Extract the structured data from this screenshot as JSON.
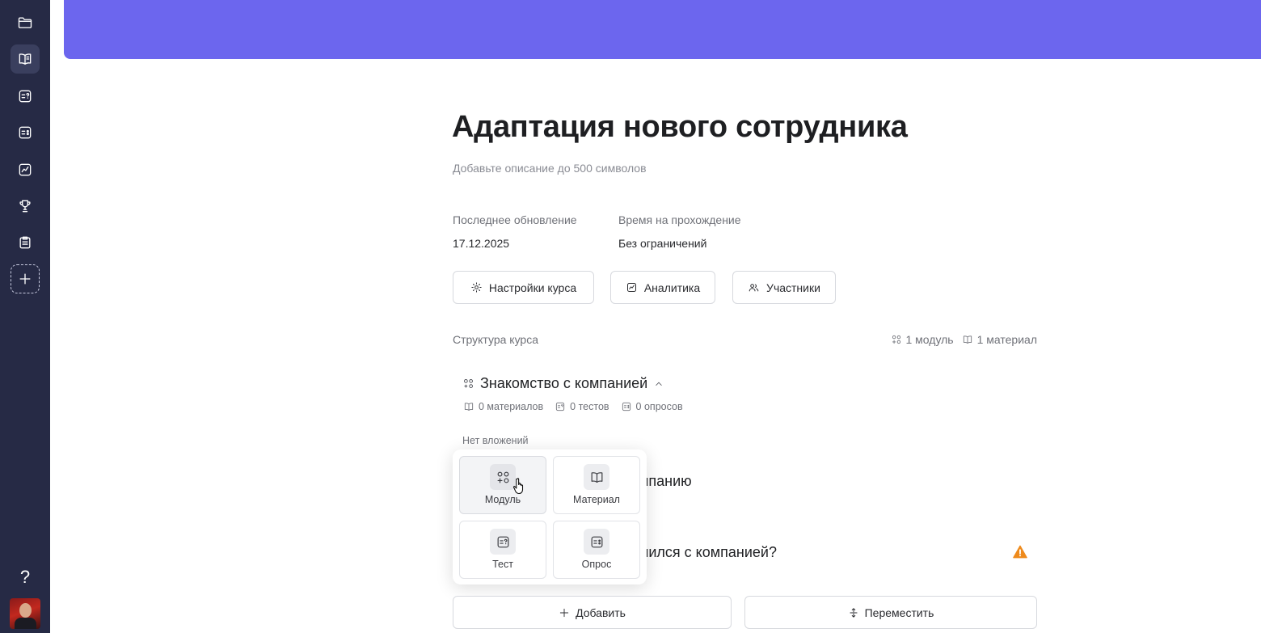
{
  "sidebar": {
    "items": [
      {
        "icon": "folder-icon"
      },
      {
        "icon": "book-icon",
        "active": true
      },
      {
        "icon": "test-icon"
      },
      {
        "icon": "survey-icon"
      },
      {
        "icon": "analytics-icon"
      },
      {
        "icon": "trophy-icon"
      },
      {
        "icon": "clipboard-icon"
      },
      {
        "icon": "plus-icon"
      }
    ],
    "help_label": "?"
  },
  "colors": {
    "banner": "#6c66ee",
    "sidebar": "#262a45",
    "warning": "#ee8a1c"
  },
  "course": {
    "title": "Адаптация нового сотрудника",
    "description_placeholder": "Добавьте описание до 500 символов",
    "meta": {
      "updated_label": "Последнее обновление",
      "updated_value": "17.12.2025",
      "time_label": "Время на прохождение",
      "time_value": "Без ограничений"
    },
    "actions": {
      "settings": "Настройки курса",
      "analytics": "Аналитика",
      "participants": "Участники"
    }
  },
  "structure": {
    "label": "Структура курса",
    "modules_count": "1 модуль",
    "materials_count": "1 материал",
    "module": {
      "title": "Знакомство с компанией",
      "materials": "0 материалов",
      "tests": "0 тестов",
      "surveys": "0 опросов",
      "empty_note": "Нет вложений"
    },
    "hidden_item_1": "мпанию",
    "hidden_item_2": "мился с компанией?"
  },
  "popup": {
    "module": "Модуль",
    "material": "Материал",
    "test": "Тест",
    "survey": "Опрос"
  },
  "bottom": {
    "add": "Добавить",
    "move": "Переместить"
  }
}
